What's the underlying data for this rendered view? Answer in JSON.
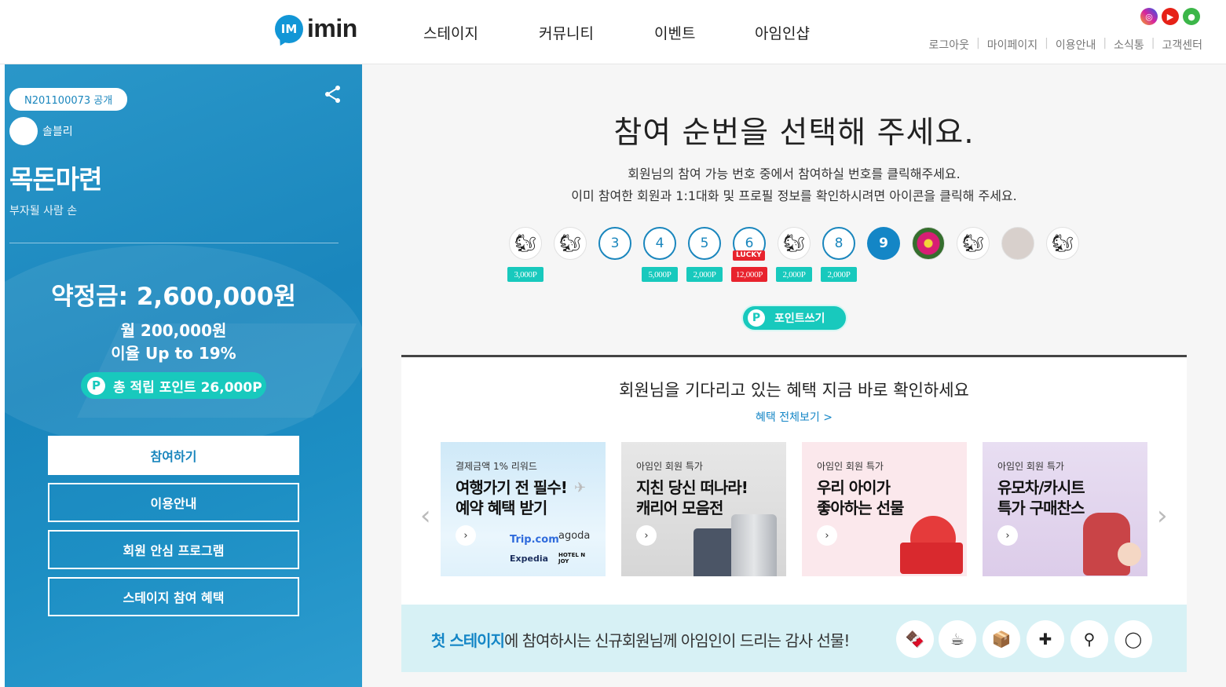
{
  "header": {
    "logo_text": "imin",
    "nav": [
      "스테이지",
      "커뮤니티",
      "이벤트",
      "아임인샵"
    ],
    "util": [
      "로그아웃",
      "마이페이지",
      "이용안내",
      "소식통",
      "고객센터"
    ],
    "sns_icons": [
      "instagram-icon",
      "youtube-icon",
      "kakao-story-icon"
    ]
  },
  "stage": {
    "code": "N201100073 공개",
    "user_name": "솔블리",
    "title": "목돈마련",
    "subtitle": "부자될 사람 손",
    "amount": "약정금: 2,600,000원",
    "monthly": "월 200,000원",
    "rate": "이율 Up to 19%",
    "points_label": "총 적립 포인트 26,000P",
    "points_badge": "P",
    "buttons": [
      "참여하기",
      "이용안내",
      "회원 안심 프로그램",
      "스테이지 참여 혜택"
    ]
  },
  "selection": {
    "heading": "참여 순번을 선택해 주세요.",
    "desc1": "회원님의 참여 가능 번호 중에서 참여하실 번호를 클릭해주세요.",
    "desc2": "이미 참여한 회원과 1:1대화 및 프로필 정보를 확인하시려면 아이콘을 클릭해 주세요.",
    "slots": [
      {
        "label": "",
        "kind": "avatar",
        "reward": "3,000P"
      },
      {
        "label": "",
        "kind": "avatar",
        "reward": ""
      },
      {
        "label": "3",
        "kind": "number",
        "reward": ""
      },
      {
        "label": "4",
        "kind": "number",
        "reward": "5,000P"
      },
      {
        "label": "5",
        "kind": "number",
        "reward": "2,000P"
      },
      {
        "label": "6",
        "kind": "number",
        "reward": "12,000P",
        "lucky": "LUCKY"
      },
      {
        "label": "",
        "kind": "avatar",
        "reward": "2,000P"
      },
      {
        "label": "8",
        "kind": "number",
        "reward": "2,000P"
      },
      {
        "label": "9",
        "kind": "selected",
        "reward": ""
      },
      {
        "label": "",
        "kind": "flower",
        "reward": ""
      },
      {
        "label": "",
        "kind": "avatar",
        "reward": ""
      },
      {
        "label": "",
        "kind": "text-avatar",
        "reward": ""
      },
      {
        "label": "",
        "kind": "avatar",
        "reward": ""
      }
    ],
    "point_button": "포인트쓰기",
    "point_badge": "P"
  },
  "benefits": {
    "heading": "회원님을 기다리고 있는 혜택 지금 바로 확인하세요",
    "more": "혜택 전체보기 >",
    "cards": [
      {
        "category": "결제금액 1% 리워드",
        "line1": "여행가기 전 필수!",
        "line2": "예약 혜택 받기",
        "brands": [
          "Trip.com",
          "agoda",
          "Expedia",
          "HOTEL N JOY"
        ]
      },
      {
        "category": "아임인 회원 특가",
        "line1": "지친 당신 떠나라!",
        "line2": "캐리어 모음전"
      },
      {
        "category": "아임인 회원 특가",
        "line1": "우리 아이가",
        "line2": "좋아하는 선물"
      },
      {
        "category": "아임인 회원 특가",
        "line1": "유모차/카시트",
        "line2": "특가 구매찬스"
      }
    ],
    "gift_highlight": "첫 스테이지",
    "gift_text": "에 참여하시는 신규회원님께 아임인이 드리는 감사 선물!"
  }
}
